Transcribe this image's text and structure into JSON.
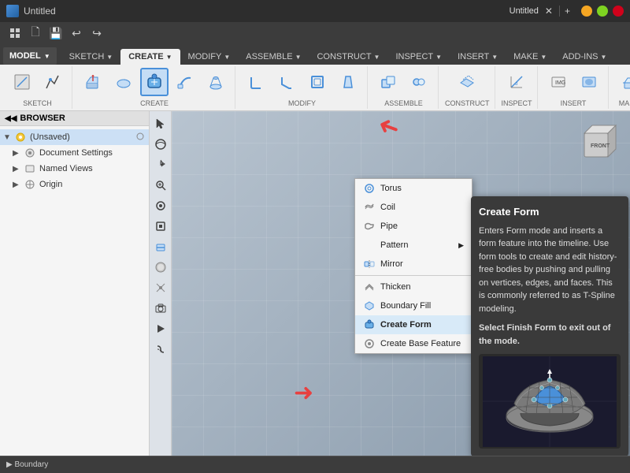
{
  "titleBar": {
    "title": "Untitled",
    "closeLabel": "✕",
    "newTabLabel": "+"
  },
  "quickToolbar": {
    "gridLabel": "⊞",
    "docLabel": "🗋",
    "saveLabel": "💾",
    "undoLabel": "↩",
    "redoLabel": "↪"
  },
  "ribbonTabs": [
    {
      "id": "solid",
      "label": "MODEL",
      "active": false,
      "hasDropdown": true
    },
    {
      "id": "sketch",
      "label": "SKETCH",
      "active": false,
      "hasDropdown": true
    },
    {
      "id": "create",
      "label": "CREATE",
      "active": true,
      "hasDropdown": true
    },
    {
      "id": "modify",
      "label": "MODIFY",
      "active": false,
      "hasDropdown": true
    },
    {
      "id": "assemble",
      "label": "ASSEMBLE",
      "active": false,
      "hasDropdown": true
    },
    {
      "id": "construct",
      "label": "CONSTRUCT",
      "active": false,
      "hasDropdown": true
    },
    {
      "id": "inspect",
      "label": "INSPECT",
      "active": false,
      "hasDropdown": true
    },
    {
      "id": "insert",
      "label": "INSERT",
      "active": false,
      "hasDropdown": true
    },
    {
      "id": "make",
      "label": "MAKE",
      "active": false,
      "hasDropdown": true
    },
    {
      "id": "addins",
      "label": "ADD-INS",
      "active": false,
      "hasDropdown": true
    }
  ],
  "browser": {
    "header": "BROWSER",
    "items": [
      {
        "id": "root",
        "label": "(Unsaved)",
        "level": 0,
        "hasExpand": true,
        "expanded": true,
        "icon": "light"
      },
      {
        "id": "docsettings",
        "label": "Document Settings",
        "level": 1,
        "hasExpand": true,
        "expanded": false,
        "icon": "gear"
      },
      {
        "id": "namedviews",
        "label": "Named Views",
        "level": 1,
        "hasExpand": true,
        "expanded": false,
        "icon": "folder"
      },
      {
        "id": "origin",
        "label": "Origin",
        "level": 1,
        "hasExpand": true,
        "expanded": false,
        "icon": "origin"
      }
    ]
  },
  "createMenu": {
    "items": [
      {
        "id": "torus",
        "label": "Torus",
        "icon": "○",
        "hasArrow": false
      },
      {
        "id": "coil",
        "label": "Coil",
        "icon": "≋",
        "hasArrow": false
      },
      {
        "id": "pipe",
        "label": "Pipe",
        "icon": "⌀",
        "hasArrow": false
      },
      {
        "id": "pattern",
        "label": "Pattern",
        "icon": "",
        "hasArrow": true
      },
      {
        "id": "mirror",
        "label": "Mirror",
        "icon": "⧖",
        "hasArrow": false
      },
      {
        "id": "thicken",
        "label": "Thicken",
        "icon": "◧",
        "hasArrow": false
      },
      {
        "id": "boundaryfill",
        "label": "Boundary Fill",
        "icon": "⬡",
        "hasArrow": false
      },
      {
        "id": "createform",
        "label": "Create Form",
        "icon": "◈",
        "hasArrow": false,
        "highlighted": true
      },
      {
        "id": "createbase",
        "label": "Create Base Feature",
        "icon": "◉",
        "hasArrow": false
      }
    ]
  },
  "tooltip": {
    "title": "Create Form",
    "body1": "Enters Form mode and inserts a form feature into the timeline. Use form tools to create and edit history-free bodies by pushing and pulling on vertices, edges, and faces. This is commonly referred to as T-Spline modeling.",
    "body2": "Select Finish Form to exit out of the mode."
  },
  "statusBar": {
    "text1": "▶ Boundary",
    "text2": "",
    "units": ""
  },
  "arrows": {
    "topArrow": "→",
    "leftArrow": "→"
  }
}
